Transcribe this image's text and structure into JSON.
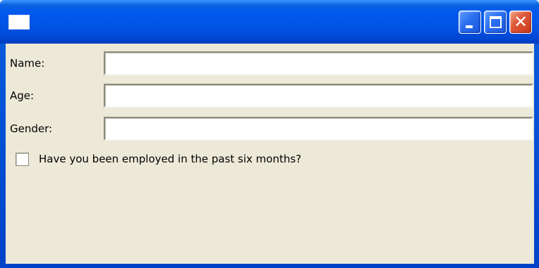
{
  "window": {
    "title": "",
    "icon": "window-app-icon",
    "colors": {
      "titlebar": "#0054e3",
      "client_background": "#ece9d8",
      "close_button": "#e0593a"
    },
    "buttons": {
      "minimize_icon": "minimize-icon",
      "maximize_icon": "maximize-icon",
      "close_icon": "close-icon",
      "close_glyph": "✕"
    }
  },
  "form": {
    "name": {
      "label": "Name:",
      "value": ""
    },
    "age": {
      "label": "Age:",
      "value": ""
    },
    "gender": {
      "label": "Gender:",
      "value": ""
    },
    "employed": {
      "label": "Have you been employed in the past six months?",
      "checked": false
    }
  }
}
